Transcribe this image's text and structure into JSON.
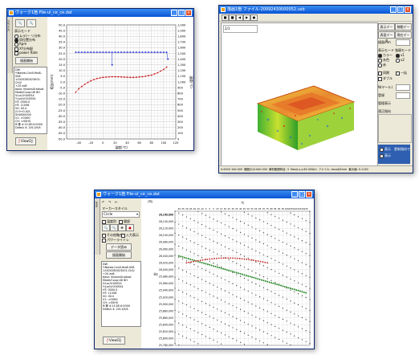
{
  "win1": {
    "title": "ヴォーク1箇 File-ul_ce_ce.dat",
    "vtab": "スライス",
    "label_display": "表示モード",
    "radios": [
      "ムラ(ー リ分布",
      "同位置分布",
      "Rpm"
    ],
    "checks": [
      "XY分布配",
      "power Rate"
    ],
    "plot_button": "描画開始",
    "info_lines": [
      "DW",
      "Y:Noteb-Coh0-Yeo8-008",
      "1:DI20280023001-Ch0/",
      "+20 ee8",
      "basic VisionsGraduat",
      "Mode/Coup<8i 8H",
      "V:Lor/V:00054",
      "Y:Lor/V:000554",
      "HT: 0000.0",
      "HT: 11058",
      "V0: 00.0",
      "(0.9+0.0)S-0H0000000",
      "V1: >00H0",
      "CH: >00H0",
      "R:第 4:13 8E:0:0000",
      "Date/s 4: 2011/9/4"
    ],
    "bottom_button": "ViewCIJ",
    "ylabel_left": "相当(mm)",
    "ylabel_right": "温度(℃)",
    "xlabel": "温度(℃)"
  },
  "win2": {
    "title": "描画1箇 ファイル-20092430000052.usb",
    "buttons_right": [
      "表示データ",
      "移動データ",
      "表面データ/表層データ",
      "表面データ",
      "現在データ"
    ],
    "labels_right": [
      "描画mm",
      "表示モード",
      "強弱モード",
      "N(ヤール)",
      "登録",
      "管理表示",
      "適正指向"
    ],
    "radios_right": [
      "カラー",
      "灰色",
      "赤",
      "x1",
      "x2"
    ],
    "checks_right": [
      "同期",
      "一括",
      "ダブル"
    ],
    "bottom_opts": [
      "表示",
      "表示",
      "更新指向で"
    ],
    "status": [
      "0.0000 100.005",
      "範囲(0)0.000.000",
      "解析範囲時目: 3",
      "Max/Lu.y:45.000t/n",
      "ファイル: result/Xmm",
      "最大値: 0.1130",
      "平均目: 1.0% 00.0",
      "ファイルB: 1.00.0%"
    ],
    "input_text": "2/1"
  },
  "win3": {
    "title": "ヴォーク1箇 File-ul_ce_ce.dat",
    "vtab": "Xfilt",
    "marker_label": "マーカースタイル",
    "marker_select": "Circle",
    "checks": [
      "温度別",
      "間部",
      "その他軸合",
      "入力表示",
      "パワーライトレ"
    ],
    "apply_button": "データ読み",
    "plot_button": "描画開始",
    "info_lines": [
      "DW",
      "Y:Noteb-Coh0-Yeo8-008",
      "1:DI20280023001-Ch0/",
      "+20 ee8",
      "basic VisionsGraduat",
      "Mode/Coup<8i 8H",
      "V:Lor/V:00054",
      "Y:Lor/V:000554",
      "HT: 0000.0",
      "HT: 11058",
      "V0: 00.0",
      "V1: >00H0",
      "CH: >00H0",
      "R:第 4:13 8E:0:0000",
      "Date/s 4: 2011/9/4"
    ],
    "bottom_button": "ViewCIJ",
    "hz_label": "Hz",
    "col_label": "(列)",
    "top_label": "℃"
  },
  "chart_data": [
    {
      "type": "line",
      "x": [
        -45,
        -40,
        -35,
        -30,
        -25,
        -20,
        -15,
        -10,
        -5,
        0,
        5,
        10,
        15,
        20,
        25,
        30,
        35,
        40,
        45,
        50,
        55,
        60,
        65,
        70,
        75,
        80,
        85,
        90,
        95,
        100,
        105
      ],
      "series": [
        {
          "values": [
            25.9,
            25.9,
            25.9,
            25.9,
            25.9,
            25.9,
            25.9,
            25.9,
            25.9,
            25.9,
            25.9,
            25.9,
            25.9,
            25.9,
            25.9,
            25.9,
            25.9,
            25.9,
            25.9,
            25.9,
            25.9,
            25.9,
            25.9,
            25.9,
            25.9,
            25.9,
            25.9,
            25.9,
            25.9,
            25.9,
            25.9
          ],
          "color": "#1f2fd0"
        },
        {
          "values": [
            -9,
            -6,
            -4,
            -2,
            -0.5,
            1,
            2,
            3,
            3.5,
            4,
            4.2,
            4.4,
            4.5,
            4.5,
            4.4,
            4.3,
            4.2,
            4.1,
            4,
            4,
            4.1,
            4.3,
            4.6,
            5,
            5.5,
            6,
            7,
            8,
            9.5,
            11,
            13
          ],
          "color": "#c81818"
        }
      ],
      "xticks": [
        "-40",
        "-20",
        "0",
        "20",
        "40",
        "60",
        "80",
        "100",
        "120"
      ],
      "yticks_left": [
        "50.0",
        "45.0",
        "40.0",
        "35.0",
        "30.0",
        "25.0",
        "20.0",
        "15.0",
        "10.0",
        "5.0",
        "0.0",
        "-5.0",
        "-10.0",
        "-15.0",
        "-20.0",
        "-25.0",
        "-30.0",
        "-35.0",
        "-40.0",
        "-45.0",
        "-50.0"
      ],
      "yticks_right": [
        "1,000",
        "1,900",
        "1,800",
        "1,700",
        "1,600",
        "1,500",
        "1,400",
        "1,300",
        "1,200",
        "1,100",
        "1,000",
        "900",
        "800",
        "700",
        "600",
        "500",
        "400",
        "300",
        "200",
        "100",
        "0"
      ],
      "xlim": [
        -60,
        120
      ],
      "ylim": [
        -50,
        50
      ],
      "grid": true
    },
    {
      "type": "scatter",
      "xticks": [
        "-40",
        "-35",
        "-30",
        "-25",
        "-20",
        "-15",
        "-10",
        "-5",
        "0",
        "5",
        "10",
        "15",
        "20",
        "25",
        "30",
        "35",
        "40",
        "45",
        "50",
        "55",
        "60",
        "65",
        "70",
        "75",
        "80",
        "85",
        "90",
        "95",
        "100",
        "105",
        "110",
        "115",
        "120",
        "125"
      ],
      "yticks": [
        "26,160,000",
        "26,160,000",
        "26,140,000",
        "26,120,000",
        "26,100,000",
        "26,080,000",
        "26,060,000",
        "26,040,000",
        "26,020,000",
        "26,000,000",
        "25,980,000",
        "25,960,000",
        "25,940,000",
        "25,920,000",
        "25,900,000",
        "25,880,000",
        "25,860,000",
        "25,840,000",
        "25,820,000",
        "25,800,000",
        "25,780,000"
      ],
      "ylim": [
        25780000,
        26170000
      ],
      "xlim": [
        -45,
        130
      ],
      "grid": true
    }
  ]
}
